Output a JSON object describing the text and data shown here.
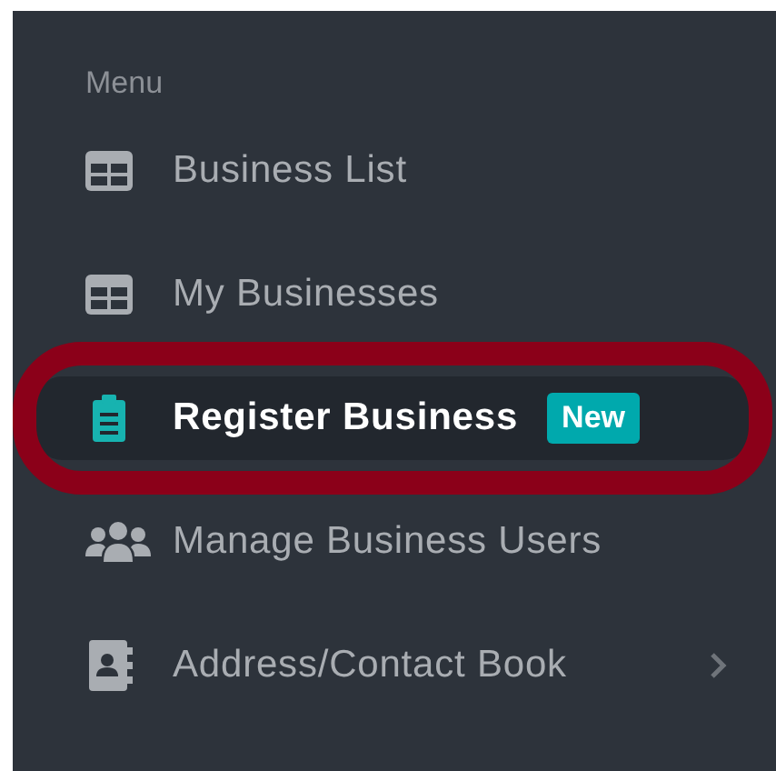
{
  "sidebar": {
    "heading": "Menu",
    "items": [
      {
        "label": "Business List",
        "selected": false,
        "expandable": false,
        "annotated": false
      },
      {
        "label": "My Businesses",
        "selected": false,
        "expandable": false,
        "annotated": false
      },
      {
        "label": "Register Business",
        "badge": "New",
        "selected": true,
        "expandable": false,
        "annotated": true
      },
      {
        "label": "Manage Business Users",
        "selected": false,
        "expandable": false,
        "annotated": false
      },
      {
        "label": "Address/Contact Book",
        "selected": false,
        "expandable": true,
        "annotated": false
      }
    ]
  }
}
